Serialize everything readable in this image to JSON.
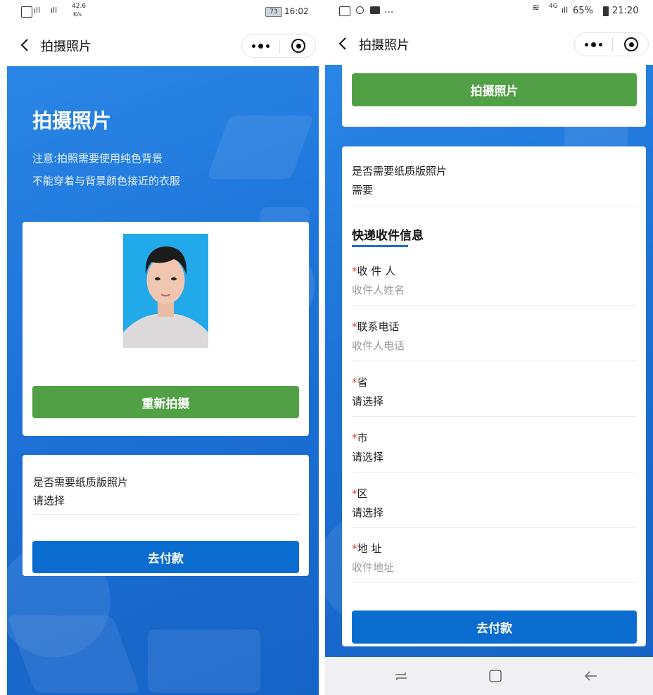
{
  "left": {
    "status": {
      "net_speed": "42.6",
      "net_unit": "K/s",
      "battery": "73",
      "time": "16:02"
    },
    "nav_title": "拍摄照片",
    "page_title": "拍摄照片",
    "notes": [
      "注意:拍照需要使用纯色背景",
      "不能穿着与背景颜色接近的衣服"
    ],
    "retake_label": "重新拍摄",
    "paper_label": "是否需要纸质版照片",
    "paper_value": "请选择",
    "pay_label": "去付款"
  },
  "right": {
    "status": {
      "dots": "...",
      "net": "4G",
      "battery": "65%",
      "time": "21:20"
    },
    "nav_title": "拍摄照片",
    "take_label": "拍摄照片",
    "paper_label": "是否需要纸质版照片",
    "paper_value": "需要",
    "section_title": "快递收件信息",
    "fields": [
      {
        "label": "收 件 人",
        "placeholder": "收件人姓名"
      },
      {
        "label": "联系电话",
        "placeholder": "收件人电话"
      },
      {
        "label": "省",
        "value": "请选择"
      },
      {
        "label": "市",
        "value": "请选择"
      },
      {
        "label": "区",
        "value": "请选择"
      },
      {
        "label": "地 址",
        "placeholder": "收件地址"
      }
    ],
    "pay_label": "去付款"
  },
  "colors": {
    "primary_blue": "#0b6ccf",
    "green": "#52a046",
    "required_star": "#e0422f",
    "background_blue": "#1d72d8"
  }
}
